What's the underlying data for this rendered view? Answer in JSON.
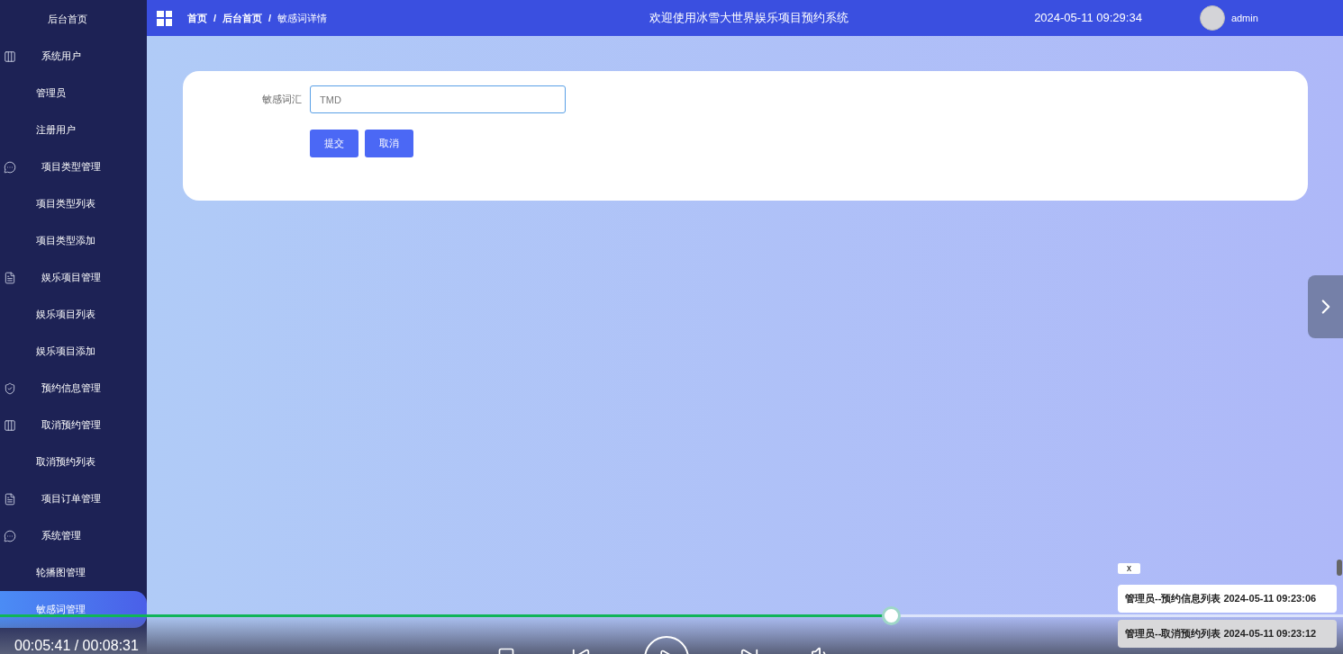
{
  "sidebar": {
    "items": [
      {
        "label": "后台首页",
        "kind": "top",
        "selected": false
      },
      {
        "label": "系统用户",
        "kind": "group",
        "selected": false
      },
      {
        "label": "管理员",
        "kind": "sub",
        "selected": false
      },
      {
        "label": "注册用户",
        "kind": "sub",
        "selected": false
      },
      {
        "label": "项目类型管理",
        "kind": "group",
        "selected": false
      },
      {
        "label": "项目类型列表",
        "kind": "sub",
        "selected": false
      },
      {
        "label": "项目类型添加",
        "kind": "sub",
        "selected": false
      },
      {
        "label": "娱乐项目管理",
        "kind": "group",
        "selected": false
      },
      {
        "label": "娱乐项目列表",
        "kind": "sub",
        "selected": false
      },
      {
        "label": "娱乐项目添加",
        "kind": "sub",
        "selected": false
      },
      {
        "label": "预约信息管理",
        "kind": "group",
        "selected": false
      },
      {
        "label": "取消预约管理",
        "kind": "group",
        "selected": false
      },
      {
        "label": "取消预约列表",
        "kind": "sub",
        "selected": false
      },
      {
        "label": "项目订单管理",
        "kind": "group",
        "selected": false
      },
      {
        "label": "系统管理",
        "kind": "group",
        "selected": false
      },
      {
        "label": "轮播图管理",
        "kind": "sub",
        "selected": false
      },
      {
        "label": "敏感词管理",
        "kind": "sub",
        "selected": true
      }
    ]
  },
  "header": {
    "breadcrumb": [
      "首页",
      "后台首页",
      "敏感词详情"
    ],
    "separator": "/",
    "title": "欢迎使用冰雪大世界娱乐项目预约系统",
    "datetime": "2024-05-11 09:29:34",
    "user": "admin"
  },
  "form": {
    "field_label": "敏感词汇",
    "value": "TMD",
    "buttons": [
      "提交",
      "取消"
    ]
  },
  "notifications": {
    "close": "x",
    "items": [
      "管理员--预约信息列表 2024-05-11 09:23:06",
      "管理员--取消预约列表 2024-05-11 09:23:12"
    ]
  },
  "video_player": {
    "level": 0.663,
    "time": "00:05:41 / 00:08:31"
  }
}
